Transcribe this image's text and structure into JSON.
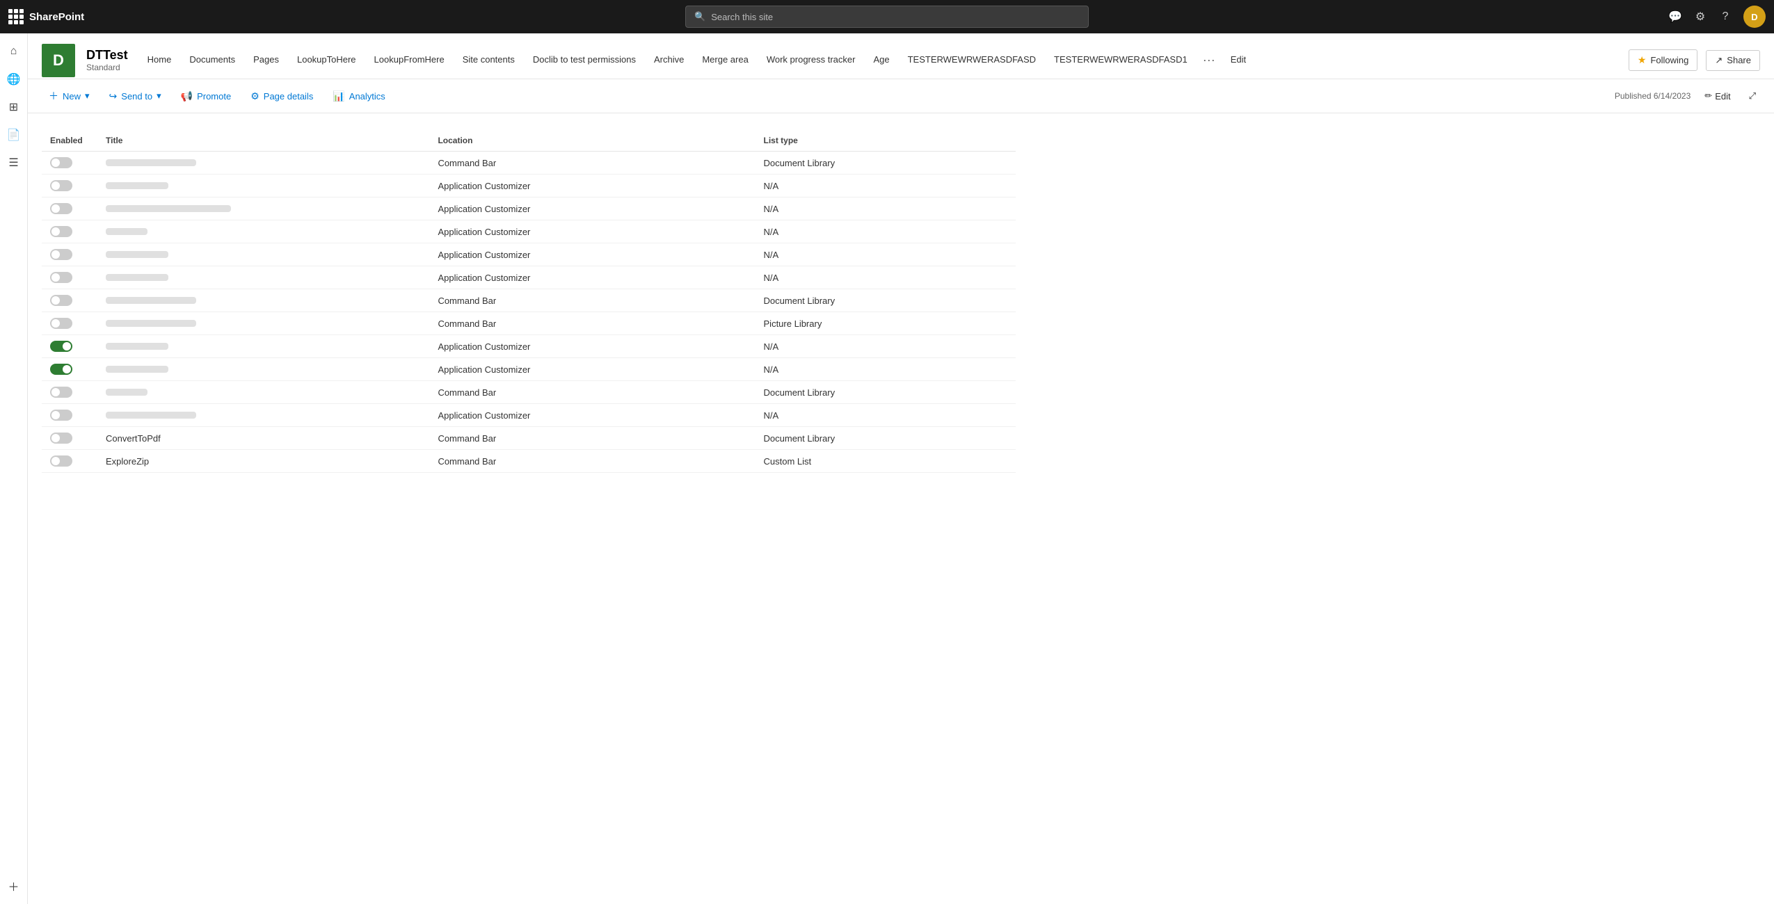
{
  "app": {
    "name": "SharePoint"
  },
  "topbar": {
    "search_placeholder": "Search this site",
    "settings_icon": "⚙",
    "help_icon": "?",
    "avatar_initials": "D"
  },
  "sidebar": {
    "items": [
      {
        "label": "Home",
        "icon": "⌂"
      },
      {
        "label": "Globe",
        "icon": "🌐"
      },
      {
        "label": "Layers",
        "icon": "⊞"
      },
      {
        "label": "Document",
        "icon": "📄"
      },
      {
        "label": "List",
        "icon": "☰"
      },
      {
        "label": "Add",
        "icon": "+"
      }
    ]
  },
  "site": {
    "logo_letter": "D",
    "title": "DTTest",
    "type": "Standard",
    "nav": [
      {
        "label": "Home",
        "active": false
      },
      {
        "label": "Documents",
        "active": false
      },
      {
        "label": "Pages",
        "active": false
      },
      {
        "label": "LookupToHere",
        "active": false
      },
      {
        "label": "LookupFromHere",
        "active": false
      },
      {
        "label": "Site contents",
        "active": false
      },
      {
        "label": "Doclib to test permissions",
        "active": false
      },
      {
        "label": "Archive",
        "active": false
      },
      {
        "label": "Merge area",
        "active": false
      },
      {
        "label": "Work progress tracker",
        "active": false
      },
      {
        "label": "Age",
        "active": false
      },
      {
        "label": "TESTERWEWRWERASDFASD",
        "active": false
      },
      {
        "label": "TESTERWEWRWERASDFASD1",
        "active": false
      }
    ],
    "following_label": "Following",
    "share_label": "Share",
    "edit_label": "Edit"
  },
  "actionbar": {
    "new_label": "New",
    "sendto_label": "Send to",
    "promote_label": "Promote",
    "pagedetails_label": "Page details",
    "analytics_label": "Analytics",
    "published_text": "Published 6/14/2023",
    "edit_page_label": "Edit"
  },
  "table": {
    "columns": [
      "Enabled",
      "Title",
      "Location",
      "List type"
    ],
    "rows": [
      {
        "enabled": "off",
        "title_skeleton": "lg",
        "location": "Command Bar",
        "list_type": "Document Library",
        "title_text": null
      },
      {
        "enabled": "off",
        "title_skeleton": "md",
        "location": "Application Customizer",
        "list_type": "N/A",
        "title_text": null
      },
      {
        "enabled": "off",
        "title_skeleton": "xl",
        "location": "Application Customizer",
        "list_type": "N/A",
        "title_text": null
      },
      {
        "enabled": "off",
        "title_skeleton": "sm",
        "location": "Application Customizer",
        "list_type": "N/A",
        "title_text": null
      },
      {
        "enabled": "off",
        "title_skeleton": "md",
        "location": "Application Customizer",
        "list_type": "N/A",
        "title_text": null
      },
      {
        "enabled": "off",
        "title_skeleton": "md",
        "location": "Application Customizer",
        "list_type": "N/A",
        "title_text": null
      },
      {
        "enabled": "off",
        "title_skeleton": "lg",
        "location": "Command Bar",
        "list_type": "Document Library",
        "title_text": null
      },
      {
        "enabled": "off",
        "title_skeleton": "lg",
        "location": "Command Bar",
        "list_type": "Picture Library",
        "title_text": null
      },
      {
        "enabled": "on-green",
        "title_skeleton": "md",
        "location": "Application Customizer",
        "list_type": "N/A",
        "title_text": null
      },
      {
        "enabled": "on-green",
        "title_skeleton": "md",
        "location": "Application Customizer",
        "list_type": "N/A",
        "title_text": null
      },
      {
        "enabled": "off",
        "title_skeleton": "sm",
        "location": "Command Bar",
        "list_type": "Document Library",
        "title_text": null
      },
      {
        "enabled": "off",
        "title_skeleton": "lg",
        "location": "Application Customizer",
        "list_type": "N/A",
        "title_text": null
      },
      {
        "enabled": "off",
        "title_skeleton": null,
        "location": "Command Bar",
        "list_type": "Document Library",
        "title_text": "ConvertToPdf"
      },
      {
        "enabled": "off",
        "title_skeleton": null,
        "location": "Command Bar",
        "list_type": "Custom List",
        "title_text": "ExploreZip"
      }
    ]
  }
}
